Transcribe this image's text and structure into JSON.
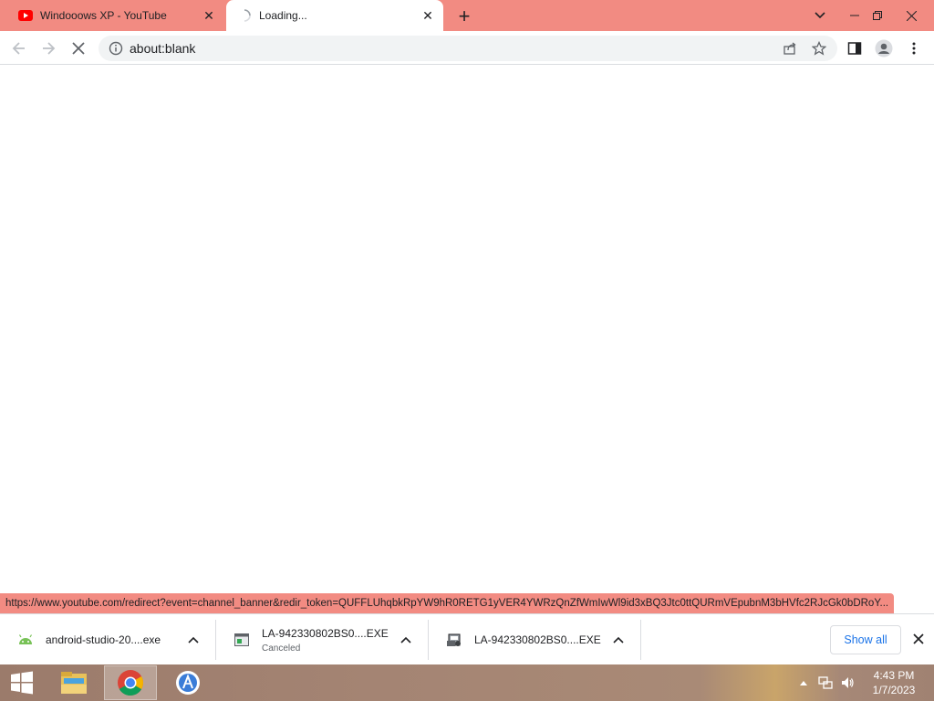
{
  "browser": {
    "tabs": [
      {
        "title": "Windooows XP - YouTube",
        "favicon": "youtube-icon",
        "active": false
      },
      {
        "title": "Loading...",
        "favicon": "loading-spinner-icon",
        "active": true
      }
    ],
    "address": "about:blank",
    "accent_color": "#f28b82"
  },
  "status_url": "https://www.youtube.com/redirect?event=channel_banner&redir_token=QUFFLUhqbkRpYW9hR0RETG1yVER4YWRzQnZfWmIwWl9id3xBQ3Jtc0ttQURmVEpubnM3bHVfc2RJcGk0bDRoY...",
  "downloads": {
    "items": [
      {
        "name": "android-studio-20....exe",
        "status": "",
        "icon": "android-icon"
      },
      {
        "name": "LA-942330802BS0....EXE",
        "status": "Canceled",
        "icon": "installer-icon"
      },
      {
        "name": "LA-942330802BS0....EXE",
        "status": "",
        "icon": "setup-icon"
      }
    ],
    "show_all_label": "Show all"
  },
  "taskbar": {
    "apps": [
      "start-icon",
      "file-explorer-icon",
      "chrome-icon",
      "android-studio-icon"
    ],
    "active_app": "chrome-icon",
    "time": "4:43 PM",
    "date": "1/7/2023"
  }
}
